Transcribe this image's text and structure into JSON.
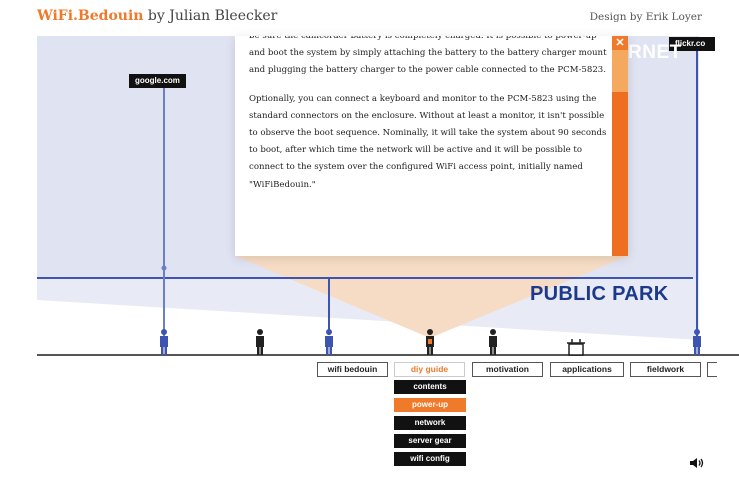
{
  "header": {
    "brand": "WiFi.Bedouin",
    "byline": " by Julian Bleecker",
    "credit": "Design by Erik Loyer"
  },
  "tags": {
    "google": "google.com",
    "flickr": "flickr.co"
  },
  "scene": {
    "zone_label": "PUBLIC PARK",
    "top_zone_label": "RNET",
    "colors": {
      "sky": "#dfe3f2",
      "network_line": "#3d55b0",
      "ground_line": "#555555",
      "accent": "#ee7a2a",
      "beam": "#f6dcc4",
      "zone_text": "#1d3a8a"
    }
  },
  "popup": {
    "paragraphs": [
      "be sure the camcorder battery is completely charged. It is possible to power-up and boot the system by simply attaching the battery to the battery charger mount and plugging the battery charger to the power cable connected to the PCM-5823.",
      "Optionally, you can connect a keyboard and monitor to the PCM-5823 using the standard connectors on the enclosure. Without at least a monitor, it isn't possible to observe the boot sequence. Nominally, it will take the system about 90 seconds to boot, after which time the network will be active and it will be possible to connect to the system over the configured WiFi access point, initially named \"WiFiBedouin.\""
    ],
    "close_label": "✕"
  },
  "nav": {
    "items": [
      {
        "label": "wifi bedouin"
      },
      {
        "label": "diy guide"
      },
      {
        "label": "motivation"
      },
      {
        "label": "applications"
      },
      {
        "label": "fieldwork"
      },
      {
        "label": ""
      }
    ],
    "active_index": 1
  },
  "submenu": {
    "items": [
      {
        "label": "contents"
      },
      {
        "label": "power-up"
      },
      {
        "label": "network"
      },
      {
        "label": "server gear"
      },
      {
        "label": "wifi config"
      }
    ],
    "active_index": 1
  },
  "icons": {
    "speaker": "speaker-icon",
    "close": "close-icon"
  }
}
